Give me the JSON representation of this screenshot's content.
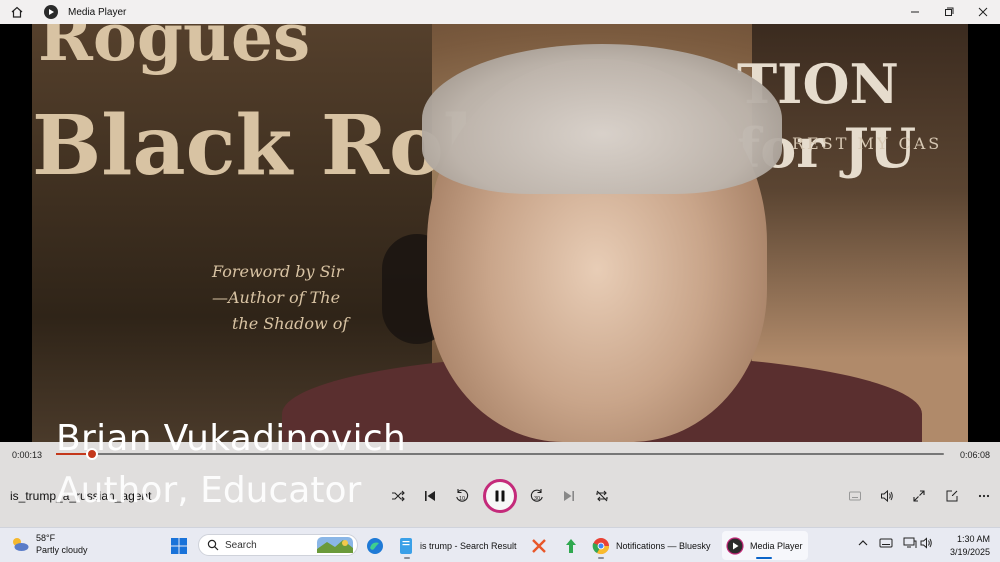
{
  "window": {
    "title": "Media Player"
  },
  "video": {
    "caption_name": "Brian Vukadinovich",
    "caption_role": "Author, Educator",
    "poster_line1": "Rogues",
    "poster_line2": "Black Rob",
    "poster_line3": "Foreword by Sir",
    "poster_line4": "—Author of The",
    "poster_line5": "the Shadow of",
    "poster_right1": "TION for JU",
    "poster_right2": "REST MY CAS"
  },
  "player": {
    "current_time": "0:00:13",
    "total_time": "0:06:08",
    "progress_fraction": 0.04,
    "filename": "is_trump_a_russian_agent",
    "accent_color": "#c4381b"
  },
  "taskbar": {
    "weather_temp": "58°F",
    "weather_desc": "Partly cloudy",
    "search_label": "Search",
    "apps": [
      {
        "label": "is trump - Search Result",
        "icon": "document-icon"
      },
      {
        "label": "Notifications — Bluesky",
        "icon": "chrome-icon"
      },
      {
        "label": "Media Player",
        "icon": "media-player-icon"
      }
    ],
    "time": "1:30 AM",
    "date": "3/19/2025"
  }
}
